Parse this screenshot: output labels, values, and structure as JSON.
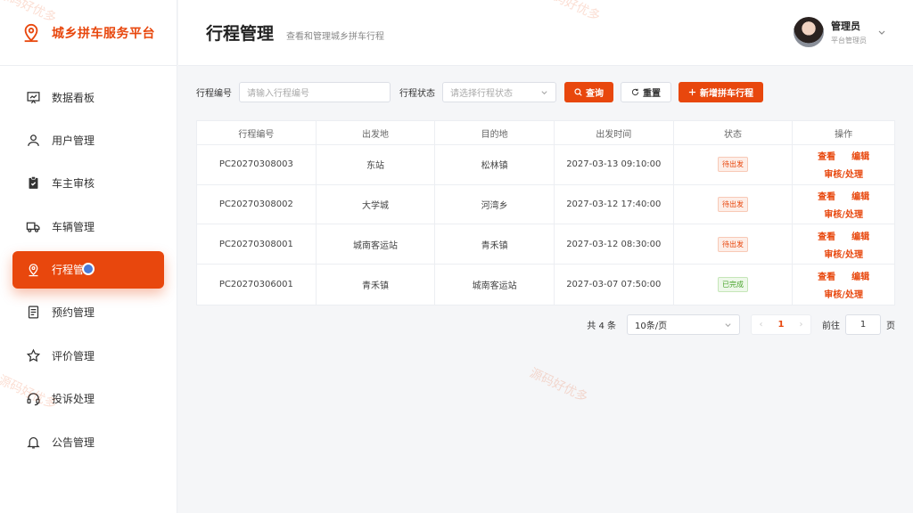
{
  "brand": {
    "title": "城乡拼车服务平台",
    "icon": "map-pin-icon"
  },
  "sidebar": {
    "items": [
      {
        "label": "数据看板",
        "icon": "dashboard-chart-icon",
        "active": false
      },
      {
        "label": "用户管理",
        "icon": "user-icon",
        "active": false
      },
      {
        "label": "车主审核",
        "icon": "clipboard-check-icon",
        "active": false
      },
      {
        "label": "车辆管理",
        "icon": "truck-icon",
        "active": false
      },
      {
        "label": "行程管",
        "icon": "map-pin-icon",
        "active": true
      },
      {
        "label": "预约管理",
        "icon": "document-icon",
        "active": false
      },
      {
        "label": "评价管理",
        "icon": "star-icon",
        "active": false
      },
      {
        "label": "投诉处理",
        "icon": "headset-icon",
        "active": false
      },
      {
        "label": "公告管理",
        "icon": "bell-icon",
        "active": false
      }
    ]
  },
  "header": {
    "title": "行程管理",
    "subtitle": "查看和管理城乡拼车行程"
  },
  "user": {
    "name": "管理员",
    "role": "平台管理员"
  },
  "filters": {
    "trip_no_label": "行程编号",
    "trip_no_placeholder": "请输入行程编号",
    "status_label": "行程状态",
    "status_placeholder": "请选择行程状态",
    "search_label": "查询",
    "reset_label": "重置",
    "add_label": "新增拼车行程"
  },
  "table": {
    "headers": [
      "行程编号",
      "出发地",
      "目的地",
      "出发时间",
      "状态",
      "操作"
    ],
    "rows": [
      {
        "id": "PC20270308003",
        "from": "东站",
        "to": "松林镇",
        "time": "2027-03-13 09:10:00",
        "status": "待出发",
        "status_type": "wait"
      },
      {
        "id": "PC20270308002",
        "from": "大学城",
        "to": "河湾乡",
        "time": "2027-03-12 17:40:00",
        "status": "待出发",
        "status_type": "wait"
      },
      {
        "id": "PC20270308001",
        "from": "城南客运站",
        "to": "青禾镇",
        "time": "2027-03-12 08:30:00",
        "status": "待出发",
        "status_type": "wait"
      },
      {
        "id": "PC20270306001",
        "from": "青禾镇",
        "to": "城南客运站",
        "time": "2027-03-07 07:50:00",
        "status": "已完成",
        "status_type": "done"
      }
    ],
    "ops": {
      "view": "查看",
      "edit": "编辑",
      "review": "审核/处理"
    }
  },
  "pagination": {
    "total": "共 4 条",
    "page_size": "10条/页",
    "current_page": "1",
    "goto_label": "前往",
    "goto_value": "1",
    "page_unit": "页"
  },
  "watermark": {
    "text": "源码好优多"
  },
  "colors": {
    "accent": "#e8470d",
    "success": "#4aa52e"
  }
}
